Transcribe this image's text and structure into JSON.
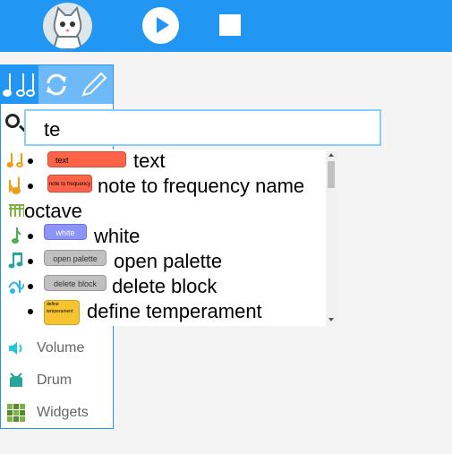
{
  "colors": {
    "toolbar": "#2196f3",
    "palette_tab_active": "#2196f3",
    "palette_tab": "#6eb9f7",
    "search_border": "#87cefa"
  },
  "toolbar": {
    "logo_icon": "cat-logo-icon",
    "play_icon": "play-icon",
    "stop_icon": "stop-icon"
  },
  "palette": {
    "tabs": [
      {
        "icon": "music-notes-icon"
      },
      {
        "icon": "refresh-icon"
      },
      {
        "icon": "pen-icon"
      }
    ],
    "items": [
      {
        "icon": "notes-icon"
      },
      {
        "icon": "flat-note-icon"
      },
      {
        "icon": "piano-icon"
      },
      {
        "icon": "tone-icon"
      },
      {
        "icon": "music-note-icon"
      },
      {
        "icon": "ornament-icon"
      },
      {
        "label": "Volume",
        "icon": "volume-icon"
      },
      {
        "label": "Drum",
        "icon": "drum-icon"
      },
      {
        "label": "Widgets",
        "icon": "widgets-icon"
      }
    ]
  },
  "search": {
    "value": "te"
  },
  "results": [
    {
      "label": "text",
      "block_label": "text",
      "block_color": "#ff6348"
    },
    {
      "label": "note to frequency name",
      "wrap": "octave",
      "block_label": "note to frequency",
      "block_color": "#ff6348"
    },
    {
      "label": "white",
      "block_label": "white",
      "block_color": "#8d93f7"
    },
    {
      "label": "open palette",
      "block_label": "open palette",
      "block_color": "#c0c0c0"
    },
    {
      "label": "delete block",
      "block_label": "delete block",
      "block_color": "#c0c0c0"
    },
    {
      "label": "define temperament",
      "block_label": "define temperament",
      "block_color": "#f7c431"
    }
  ]
}
